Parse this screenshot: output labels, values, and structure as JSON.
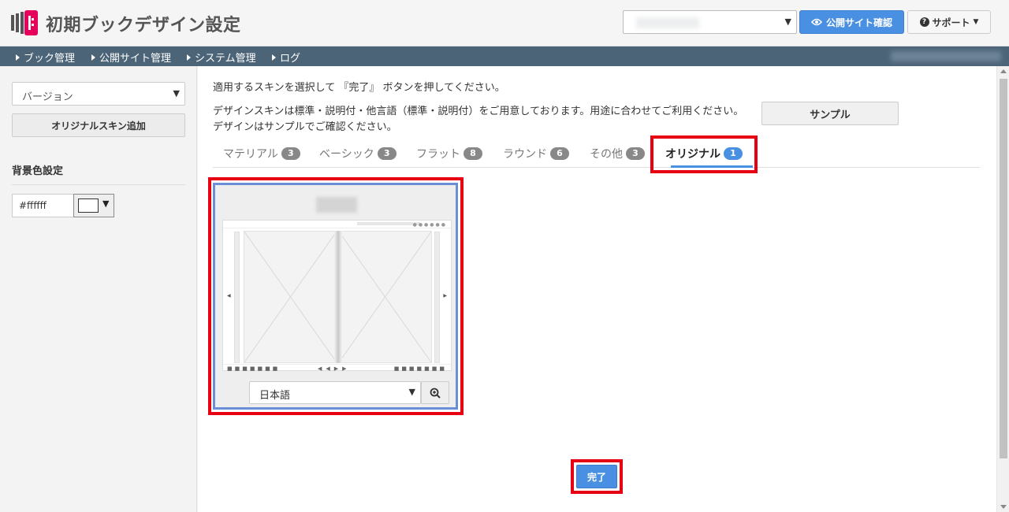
{
  "header": {
    "app_title": "初期ブックデザイン設定",
    "public_site_label": "公開サイト確認",
    "support_label": "サポート"
  },
  "nav": {
    "items": [
      {
        "label": "ブック管理"
      },
      {
        "label": "公開サイト管理"
      },
      {
        "label": "システム管理"
      },
      {
        "label": "ログ"
      }
    ]
  },
  "sidebar": {
    "version_label": "バージョン",
    "add_skin_label": "オリジナルスキン追加",
    "bg_title": "背景色設定",
    "bg_color_value": "#ffffff"
  },
  "main": {
    "instruction": "適用するスキンを選択して 『完了』 ボタンを押してください。",
    "description_line1": "デザインスキンは標準・説明付・他言語（標準・説明付）をご用意しております。用途に合わせてご利用ください。",
    "description_line2": "デザインはサンプルでご確認ください。",
    "sample_label": "サンプル",
    "tabs": [
      {
        "label": "マテリアル",
        "count": "3"
      },
      {
        "label": "ベーシック",
        "count": "3"
      },
      {
        "label": "フラット",
        "count": "8"
      },
      {
        "label": "ラウンド",
        "count": "6"
      },
      {
        "label": "その他",
        "count": "3"
      },
      {
        "label": "オリジナル",
        "count": "1"
      }
    ],
    "active_tab": "オリジナル",
    "language_selected": "日本語",
    "done_label": "完了"
  },
  "colors": {
    "accent": "#4a90e2",
    "nav_bg": "#4c6478",
    "highlight": "#e60012",
    "logo": "#e6005c"
  },
  "icons": {
    "logo": "book-logo-icon",
    "eye": "eye-icon",
    "help": "question-circle-icon",
    "zoom": "magnifier-plus-icon"
  }
}
